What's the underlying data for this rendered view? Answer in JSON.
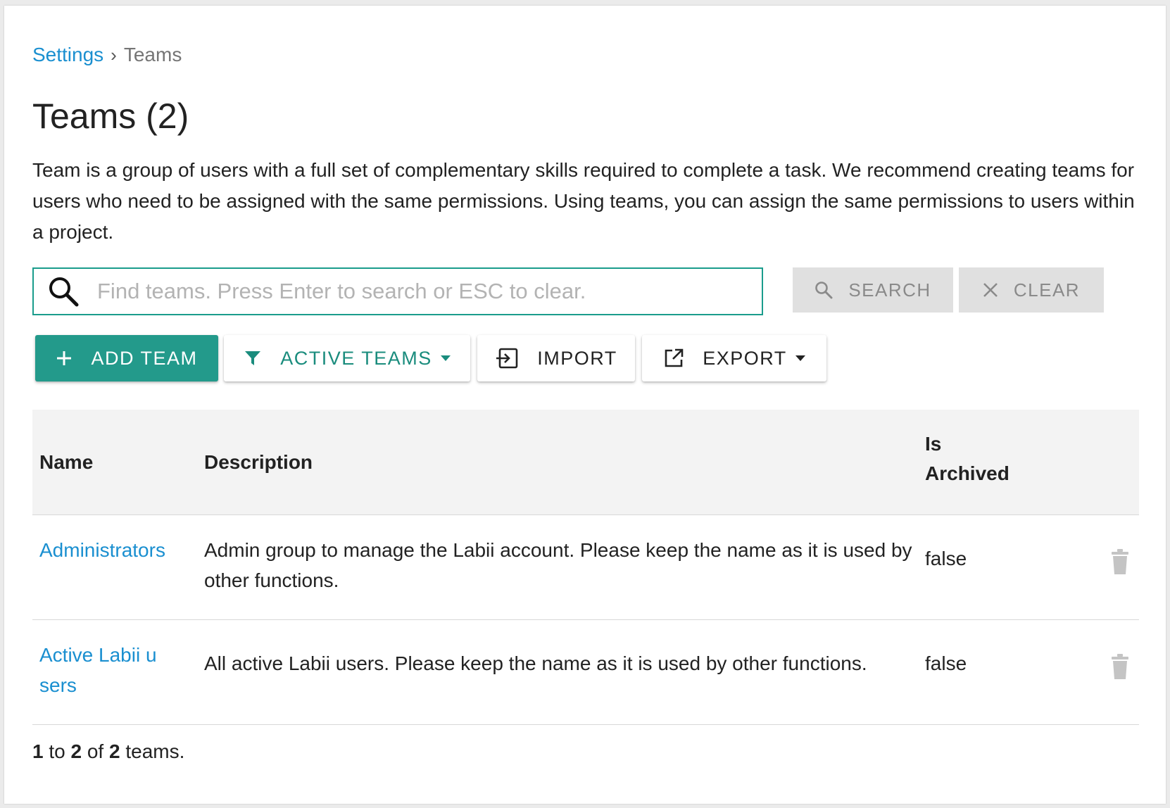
{
  "breadcrumb": {
    "parent": "Settings",
    "separator": "›",
    "current": "Teams"
  },
  "page_title": "Teams (2)",
  "intro": "Team is a group of users with a full set of complementary skills required to complete a task. We recommend creating teams for users who need to be assigned with the same permissions. Using teams, you can assign the same permissions to users within a project.",
  "search": {
    "placeholder": "Find teams. Press Enter to search or ESC to clear.",
    "value": "",
    "search_label": "SEARCH",
    "clear_label": "CLEAR"
  },
  "toolbar": {
    "add_label": "ADD TEAM",
    "filter_label": "ACTIVE TEAMS",
    "import_label": "IMPORT",
    "export_label": "EXPORT"
  },
  "table": {
    "headers": {
      "name": "Name",
      "description": "Description",
      "archived_line1": "Is",
      "archived_line2": "Archived"
    },
    "rows": [
      {
        "name": "Administrators",
        "description": "Admin group to manage the Labii account. Please keep the name as it is used by other functions.",
        "is_archived": "false"
      },
      {
        "name": "Active Labii users",
        "description": "All active Labii users. Please keep the name as it is used by other functions.",
        "is_archived": "false"
      }
    ]
  },
  "footer": {
    "from": "1",
    "to_word": "to",
    "to": "2",
    "of_word": "of",
    "total": "2",
    "suffix": "teams."
  },
  "colors": {
    "accent": "#239a8b",
    "link": "#1a8fd0"
  },
  "icons": [
    "search-icon",
    "close-icon",
    "plus-icon",
    "filter-icon",
    "import-icon",
    "export-icon",
    "trash-icon",
    "caret-down-icon"
  ]
}
